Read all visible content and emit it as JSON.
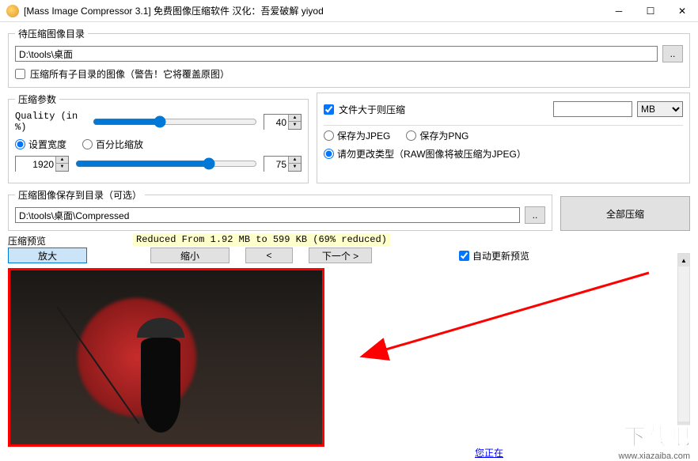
{
  "titlebar": {
    "text": "[Mass Image Compressor 3.1] 免费图像压缩软件 汉化：吾爱破解 yiyod"
  },
  "source": {
    "legend": "待压缩图像目录",
    "path": "D:\\tools\\桌面",
    "browse": "..",
    "compress_all_label": "压缩所有子目录的图像（警告！它将覆盖原图）"
  },
  "params": {
    "legend": "压缩参数",
    "quality_label": "Quality (in %)",
    "quality_value": "40",
    "width_radio": "设置宽度",
    "percent_radio": "百分比缩放",
    "width_value": "1920",
    "percent_value": "75"
  },
  "filesize": {
    "checkbox_label": "文件大于则压缩",
    "value": "",
    "unit": "MB"
  },
  "format": {
    "jpeg_label": "保存为JPEG",
    "png_label": "保存为PNG",
    "keep_label": "请勿更改类型（RAW图像将被压缩为JPEG）"
  },
  "output": {
    "legend": "压缩图像保存到目录（可选）",
    "path": "D:\\tools\\桌面\\Compressed",
    "browse": "..",
    "compress_all_btn": "全部压缩"
  },
  "preview": {
    "legend": "压缩预览",
    "info": "Reduced From 1.92 MB to 599 KB (69% reduced)",
    "zoom_in": "放大",
    "zoom_out": "缩小",
    "prev": "<",
    "next": "下一个 >",
    "auto_label": "自动更新预览"
  },
  "footer": {
    "link_partial": "您正在",
    "wm_text": "下载吧",
    "wm_url": "www.xiazaiba.com"
  }
}
